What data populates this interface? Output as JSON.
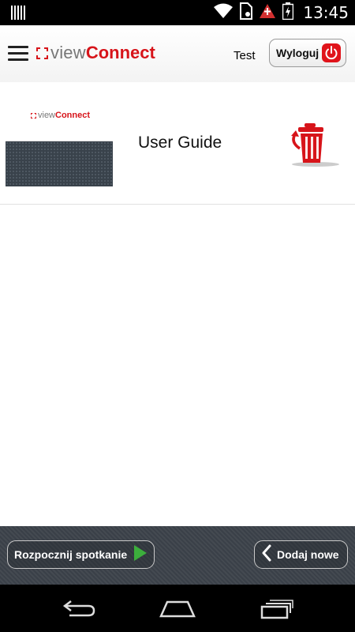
{
  "status_bar": {
    "time": "13:45",
    "icons": [
      "barcode-icon",
      "wifi-icon",
      "sim-icon",
      "alert-icon",
      "battery-icon"
    ]
  },
  "header": {
    "logo_view": "view",
    "logo_connect": "Connect",
    "user_name": "Test",
    "logout_label": "Wyloguj"
  },
  "list": {
    "items": [
      {
        "title": "User Guide",
        "thumb_logo_view": "view",
        "thumb_logo_connect": "Connect"
      }
    ]
  },
  "toolbar": {
    "start_meeting_label": "Rozpocznij spotkanie",
    "add_new_label": "Dodaj nowe"
  },
  "colors": {
    "brand_red": "#d7141a",
    "toolbar_bg": "#3a4048",
    "play_green": "#3cae3c"
  }
}
